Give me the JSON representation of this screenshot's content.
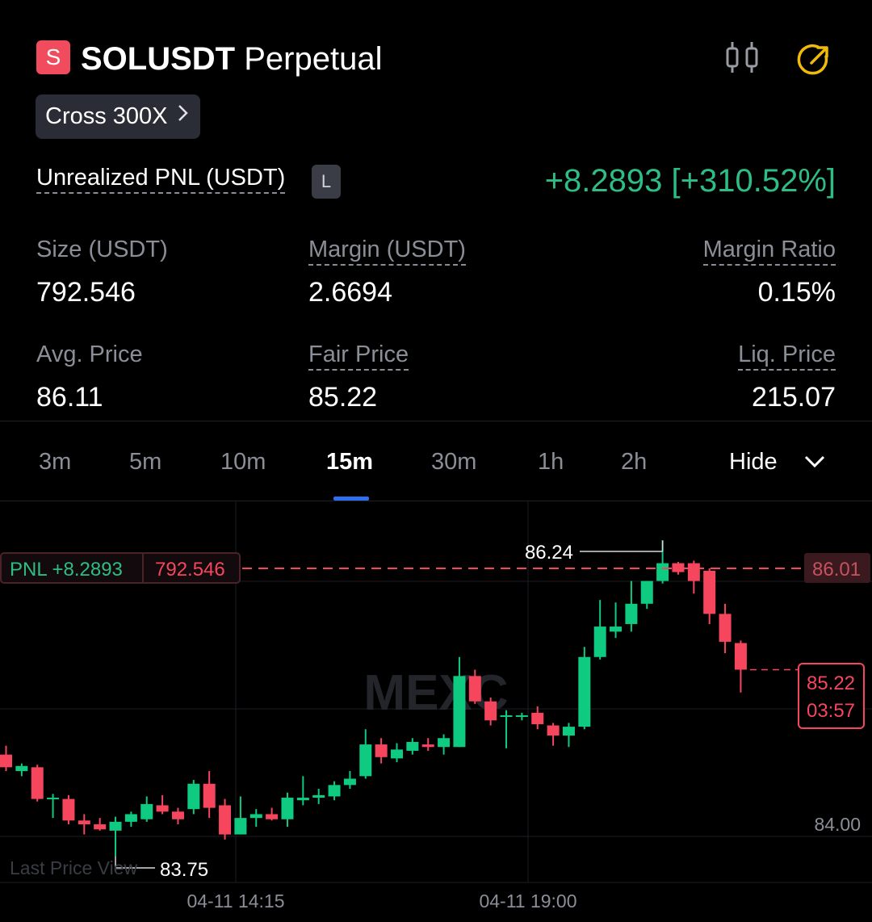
{
  "header": {
    "symbol_badge": "S",
    "symbol": "SOLUSDT",
    "contract_type": "Perpetual",
    "leverage": "Cross 300X",
    "icons": [
      "compare-icon",
      "share-icon"
    ],
    "accent_color": "#f0b90b"
  },
  "pnl": {
    "label": "Unrealized PNL (USDT)",
    "side_badge": "L",
    "value": "+8.2893 [+310.52%]",
    "color": "#2ebd85"
  },
  "stats": {
    "size_label": "Size (USDT)",
    "size_value": "792.546",
    "margin_label": "Margin (USDT)",
    "margin_value": "2.6694",
    "ratio_label": "Margin Ratio",
    "ratio_value": "0.15%",
    "avg_label": "Avg. Price",
    "avg_value": "86.11",
    "fair_label": "Fair Price",
    "fair_value": "85.22",
    "liq_label": "Liq. Price",
    "liq_value": "215.07"
  },
  "tabs": [
    {
      "label": "3m"
    },
    {
      "label": "5m"
    },
    {
      "label": "10m"
    },
    {
      "label": "15m",
      "active": true
    },
    {
      "label": "30m"
    },
    {
      "label": "1h"
    },
    {
      "label": "2h"
    }
  ],
  "hide_label": "Hide",
  "chart_data": {
    "type": "candlestick",
    "watermark": "MEXC",
    "y_tick": "84.00",
    "x_ticks": [
      "04-11 14:15",
      "04-11 19:00"
    ],
    "high_label": "86.24",
    "low_label": "83.75",
    "last_price_label": "Last Price View",
    "position_tag_pnl": "PNL +8.2893",
    "position_tag_size": "792.546",
    "entry_price_tag": "86.01",
    "current_price": "85.22",
    "countdown": "03:57",
    "up_color": "#0ecb81",
    "down_color": "#f6465d",
    "candles": [
      {
        "o": 84.55,
        "h": 84.62,
        "l": 84.42,
        "c": 84.45
      },
      {
        "o": 84.42,
        "h": 84.48,
        "l": 84.38,
        "c": 84.46
      },
      {
        "o": 84.45,
        "h": 84.47,
        "l": 84.18,
        "c": 84.2
      },
      {
        "o": 84.2,
        "h": 84.24,
        "l": 84.05,
        "c": 84.21
      },
      {
        "o": 84.2,
        "h": 84.23,
        "l": 84.0,
        "c": 84.03
      },
      {
        "o": 84.03,
        "h": 84.08,
        "l": 83.92,
        "c": 84.0
      },
      {
        "o": 84.0,
        "h": 84.05,
        "l": 83.95,
        "c": 83.96
      },
      {
        "o": 83.95,
        "h": 84.06,
        "l": 83.75,
        "c": 84.02
      },
      {
        "o": 84.02,
        "h": 84.1,
        "l": 83.98,
        "c": 84.08
      },
      {
        "o": 84.04,
        "h": 84.22,
        "l": 84.02,
        "c": 84.16
      },
      {
        "o": 84.15,
        "h": 84.23,
        "l": 84.08,
        "c": 84.1
      },
      {
        "o": 84.1,
        "h": 84.13,
        "l": 84.0,
        "c": 84.04
      },
      {
        "o": 84.12,
        "h": 84.35,
        "l": 84.08,
        "c": 84.32
      },
      {
        "o": 84.32,
        "h": 84.42,
        "l": 84.05,
        "c": 84.13
      },
      {
        "o": 84.15,
        "h": 84.2,
        "l": 83.88,
        "c": 83.92
      },
      {
        "o": 83.92,
        "h": 84.22,
        "l": 83.92,
        "c": 84.05
      },
      {
        "o": 84.05,
        "h": 84.12,
        "l": 83.98,
        "c": 84.08
      },
      {
        "o": 84.08,
        "h": 84.13,
        "l": 84.03,
        "c": 84.04
      },
      {
        "o": 84.04,
        "h": 84.25,
        "l": 83.98,
        "c": 84.21
      },
      {
        "o": 84.19,
        "h": 84.38,
        "l": 84.15,
        "c": 84.21
      },
      {
        "o": 84.21,
        "h": 84.28,
        "l": 84.16,
        "c": 84.23
      },
      {
        "o": 84.22,
        "h": 84.34,
        "l": 84.19,
        "c": 84.31
      },
      {
        "o": 84.31,
        "h": 84.42,
        "l": 84.28,
        "c": 84.36
      },
      {
        "o": 84.38,
        "h": 84.75,
        "l": 84.36,
        "c": 84.63
      },
      {
        "o": 84.63,
        "h": 84.68,
        "l": 84.48,
        "c": 84.53
      },
      {
        "o": 84.52,
        "h": 84.64,
        "l": 84.49,
        "c": 84.59
      },
      {
        "o": 84.58,
        "h": 84.68,
        "l": 84.55,
        "c": 84.65
      },
      {
        "o": 84.63,
        "h": 84.68,
        "l": 84.58,
        "c": 84.61
      },
      {
        "o": 84.61,
        "h": 84.71,
        "l": 84.55,
        "c": 84.68
      },
      {
        "o": 84.61,
        "h": 85.32,
        "l": 84.61,
        "c": 85.17
      },
      {
        "o": 85.17,
        "h": 85.22,
        "l": 84.95,
        "c": 84.97
      },
      {
        "o": 84.97,
        "h": 85.0,
        "l": 84.78,
        "c": 84.82
      },
      {
        "o": 84.85,
        "h": 84.9,
        "l": 84.6,
        "c": 84.86
      },
      {
        "o": 84.86,
        "h": 84.88,
        "l": 84.82,
        "c": 84.86
      },
      {
        "o": 84.88,
        "h": 84.93,
        "l": 84.75,
        "c": 84.79
      },
      {
        "o": 84.78,
        "h": 84.8,
        "l": 84.62,
        "c": 84.7
      },
      {
        "o": 84.7,
        "h": 84.8,
        "l": 84.61,
        "c": 84.77
      },
      {
        "o": 84.77,
        "h": 85.4,
        "l": 84.75,
        "c": 85.32
      },
      {
        "o": 85.32,
        "h": 85.77,
        "l": 85.3,
        "c": 85.56
      },
      {
        "o": 85.52,
        "h": 85.75,
        "l": 85.47,
        "c": 85.56
      },
      {
        "o": 85.58,
        "h": 85.92,
        "l": 85.52,
        "c": 85.74
      },
      {
        "o": 85.74,
        "h": 85.92,
        "l": 85.7,
        "c": 85.92
      },
      {
        "o": 85.92,
        "h": 86.24,
        "l": 85.9,
        "c": 86.06
      },
      {
        "o": 86.06,
        "h": 86.07,
        "l": 85.97,
        "c": 85.99
      },
      {
        "o": 86.06,
        "h": 86.08,
        "l": 85.82,
        "c": 85.92
      },
      {
        "o": 86.0,
        "h": 86.02,
        "l": 85.58,
        "c": 85.66
      },
      {
        "o": 85.66,
        "h": 85.74,
        "l": 85.35,
        "c": 85.44
      },
      {
        "o": 85.43,
        "h": 85.45,
        "l": 85.04,
        "c": 85.22
      }
    ]
  }
}
